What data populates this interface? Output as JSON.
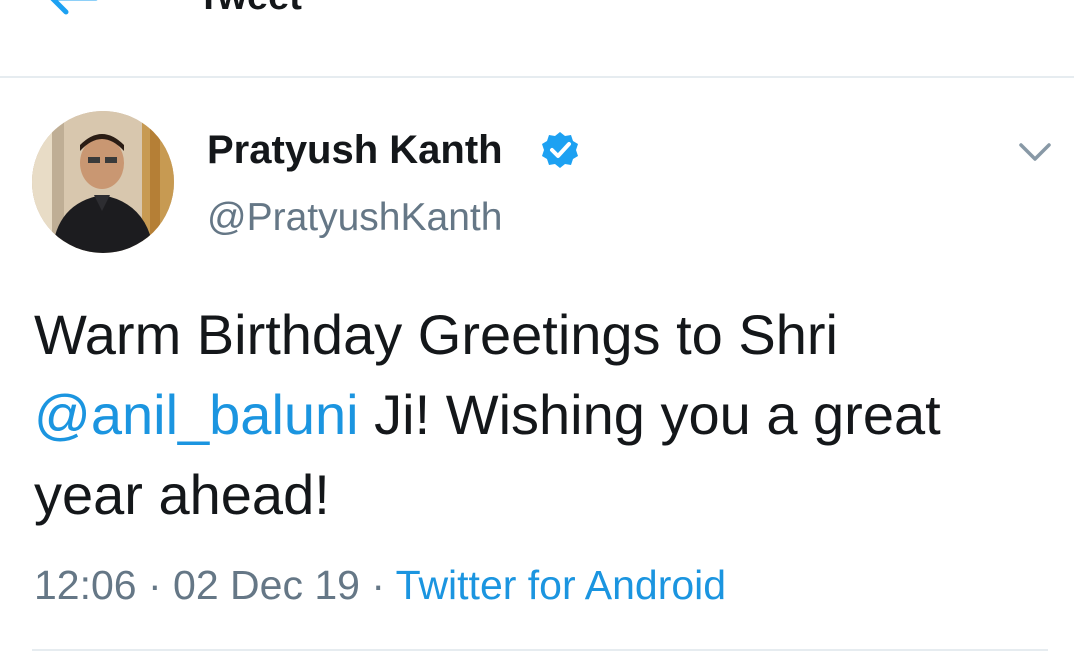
{
  "header": {
    "title": "Tweet",
    "back_icon": "arrow-left-icon"
  },
  "author": {
    "name": "Pratyush Kanth",
    "handle": "@PratyushKanth",
    "verified_icon": "verified-badge-icon"
  },
  "tweet": {
    "text_part1": "Warm Birthday Greetings to Shri ",
    "mention": "@anil_baluni",
    "text_part2": " Ji! Wishing you a great year ahead!"
  },
  "meta": {
    "time": "12:06",
    "separator": " · ",
    "date": "02 Dec 19",
    "source": "Twitter for Android"
  },
  "colors": {
    "accent": "#1b95e0",
    "text": "#14171a",
    "secondary": "#657786",
    "divider": "#e6ecf0"
  }
}
